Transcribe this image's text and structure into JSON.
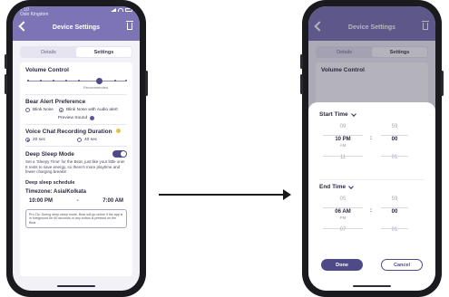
{
  "left_phone": {
    "status": {
      "time": "7:10",
      "sub": "Oslo Kingdom"
    },
    "header": {
      "title": "Device Settings"
    },
    "tabs": [
      {
        "label": "Details",
        "active": false
      },
      {
        "label": "Settings",
        "active": true
      }
    ],
    "volume": {
      "title": "Volume Control",
      "note": "Recommended",
      "level_fraction": 0.66
    },
    "alert": {
      "title": "Bear Alert Preference",
      "options": [
        {
          "label": "Blink Nose",
          "selected": false
        },
        {
          "label": "Blink Nose with Audio alert",
          "selected": true
        }
      ],
      "preview": "Preview Sound"
    },
    "voice": {
      "title": "Voice Chat Recording Duration",
      "options": [
        {
          "label": "20 sec",
          "selected": true
        },
        {
          "label": "40 sec",
          "selected": false
        }
      ]
    },
    "deep_sleep": {
      "title": "Deep Sleep Mode",
      "enabled": true,
      "description": "Set a 'Sleepy Time' for the Bear, just like your little one! It rests to save energy, so there's more playtime and fewer charging breaks!"
    },
    "schedule": {
      "title": "Deep sleep schedule",
      "timezone": "Timezone: Asia/Kolkata",
      "start": "10:00 PM",
      "separator": "-",
      "end": "7:00 AM"
    },
    "protip": "Pro-Tip: During deep sleep mode, Bear will go online if the app is in foreground for 60 seconds or any button is pressed on the Bear."
  },
  "right_phone": {
    "header": {
      "title": "Device Settings"
    },
    "tabs": [
      {
        "label": "Details",
        "active": false
      },
      {
        "label": "Settings",
        "active": true
      }
    ],
    "volume_title": "Volume Control",
    "start_picker": {
      "title": "Start Time",
      "hours_above": "09",
      "hour_selected": "10 PM",
      "ampm_below": "AM",
      "hours_below": "11",
      "minutes_above": "59",
      "minute_selected": "00",
      "minutes_below": "01"
    },
    "end_picker": {
      "title": "End Time",
      "hours_above": "05",
      "hour_selected": "06 AM",
      "ampm_below": "PM",
      "hours_below": "07",
      "minutes_above": "59",
      "minute_selected": "00",
      "minutes_below": "01"
    },
    "buttons": {
      "done": "Done",
      "cancel": "Cancel"
    }
  },
  "colors": {
    "accent": "#4e4a87",
    "header": "#7c74b4",
    "background": "#f2f1f8"
  }
}
